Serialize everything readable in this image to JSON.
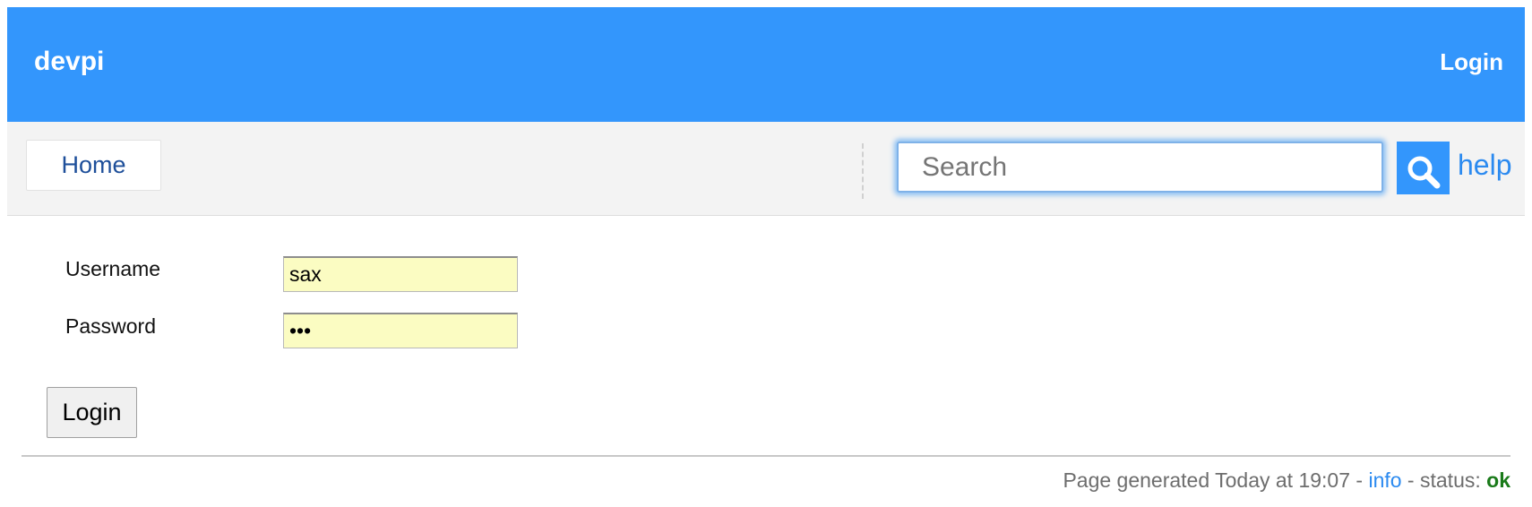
{
  "header": {
    "brand": "devpi",
    "login_label": "Login",
    "background_color": "#3396fc"
  },
  "nav": {
    "home_label": "Home",
    "search": {
      "placeholder": "Search",
      "value": "",
      "button_icon": "search-icon"
    },
    "help_label": "help"
  },
  "login_form": {
    "username_label": "Username",
    "username_value": "sax",
    "password_label": "Password",
    "password_value": "...",
    "submit_label": "Login"
  },
  "footer": {
    "generated_text": "Page generated Today at 19:07",
    "separator": " - ",
    "info_label": "info",
    "status_prefix": "status: ",
    "status_value": "ok",
    "status_color": "#1a7a1a"
  }
}
